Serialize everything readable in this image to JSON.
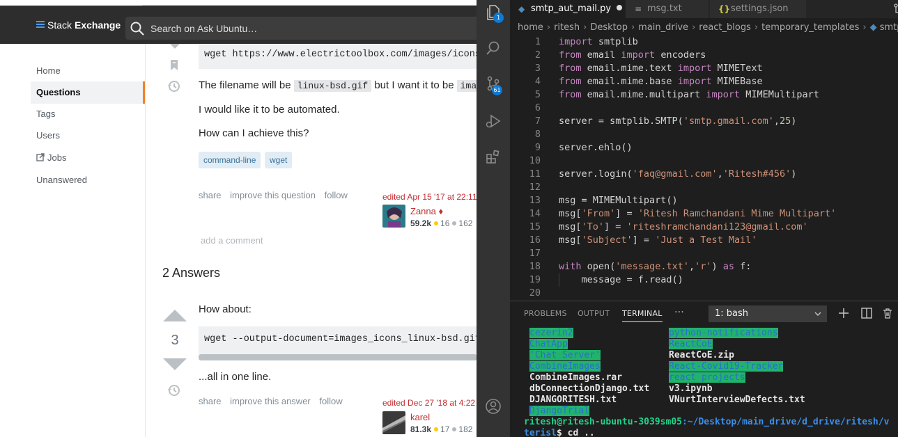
{
  "stack": {
    "brand_light": "Stack",
    "brand_bold": "Exchange",
    "search_placeholder": "Search on Ask Ubuntu…",
    "nav": {
      "home": "Home",
      "questions": "Questions",
      "tags": "Tags",
      "users": "Users",
      "jobs": "Jobs",
      "unanswered": "Unanswered"
    },
    "question": {
      "code_url": "wget https://www.electrictoolbox.com/images/icons/",
      "text1_a": "The filename will be",
      "text1_code1": "linux-bsd.gif",
      "text1_b": "but I want it to be",
      "text1_code2": "ima",
      "text2": "I would like it to be automated.",
      "text3": "How can I achieve this?",
      "tags": [
        "command-line",
        "wget"
      ],
      "share": "share",
      "improve": "improve this question",
      "follow": "follow",
      "edited": "edited Apr 15 '17 at 22:11",
      "user": "Zanna",
      "mod_mark": "♦",
      "rep": "59.2k",
      "gold": "16",
      "silver": "162",
      "add_comment": "add a comment"
    },
    "answers_header": "2 Answers",
    "answer": {
      "score": "3",
      "intro": "How about:",
      "code": "wget --output-document=images_icons_linux-bsd.gif",
      "outro": "...all in one line.",
      "share": "share",
      "improve": "improve this answer",
      "follow": "follow",
      "edited": "edited Dec 27 '18 at 4:22",
      "user": "karel",
      "rep": "81.3k",
      "gold": "17",
      "silver": "182"
    }
  },
  "vscode": {
    "tabs": [
      {
        "label": "smtp_aut_mail.py",
        "icon": "python-icon",
        "modified": true
      },
      {
        "label": "msg.txt",
        "icon": "text-lines-icon"
      },
      {
        "label": "settings.json",
        "icon": "json-braces-icon"
      }
    ],
    "badges": {
      "explorer": "1",
      "scm": "61"
    },
    "breadcrumb": [
      "home",
      "ritesh",
      "Desktop",
      "main_drive",
      "react_blogs",
      "temporary_templates",
      "smtp_a"
    ],
    "code_lines": [
      {
        "n": "1",
        "html": "<span class=\"kw\">import</span> smtplib"
      },
      {
        "n": "2",
        "html": "<span class=\"kw\">from</span> email <span class=\"kw\">import</span> encoders"
      },
      {
        "n": "3",
        "html": "<span class=\"kw\">from</span> email.mime.text <span class=\"kw\">import</span> MIMEText"
      },
      {
        "n": "4",
        "html": "<span class=\"kw\">from</span> email.mime.base <span class=\"kw\">import</span> MIMEBase"
      },
      {
        "n": "5",
        "html": "<span class=\"kw\">from</span> email.mime.multipart <span class=\"kw\">import</span> MIMEMultipart"
      },
      {
        "n": "6",
        "html": ""
      },
      {
        "n": "7",
        "html": "server = smtplib.SMTP(<span class=\"str\">'smtp.gmail.com'</span>,<span class=\"num\">25</span>)"
      },
      {
        "n": "8",
        "html": ""
      },
      {
        "n": "9",
        "html": "server.ehlo()"
      },
      {
        "n": "10",
        "html": ""
      },
      {
        "n": "11",
        "html": "server.login(<span class=\"str\">'faq@gmail.com'</span>,<span class=\"str\">'Ritesh#456'</span>)"
      },
      {
        "n": "12",
        "html": ""
      },
      {
        "n": "13",
        "html": "msg = MIMEMultipart()"
      },
      {
        "n": "14",
        "html": "msg[<span class=\"str\">'From'</span>] = <span class=\"str\">'Ritesh Ramchandani Mime Multipart'</span>"
      },
      {
        "n": "15",
        "html": "msg[<span class=\"str\">'To'</span>] = <span class=\"str\">'riteshramchandani123@gmail.com'</span>"
      },
      {
        "n": "16",
        "html": "msg[<span class=\"str\">'Subject'</span>] = <span class=\"str\">'Just a Test Mail'</span>"
      },
      {
        "n": "17",
        "html": ""
      },
      {
        "n": "18",
        "html": "<span class=\"kw\">with</span> open(<span class=\"str\">'message.txt'</span>,<span class=\"str\">'r'</span>) <span class=\"kw\">as</span> f:"
      },
      {
        "n": "19",
        "html": "    message = f.read()"
      },
      {
        "n": "20",
        "html": ""
      }
    ],
    "panel_tabs": [
      "PROBLEMS",
      "OUTPUT",
      "TERMINAL",
      "···"
    ],
    "terminal_select": "1: bash",
    "terminal_col1": [
      {
        "t": "cezerin2",
        "hl": true
      },
      {
        "t": "ChatApp",
        "hl": true
      },
      {
        "t": "'Chat Server'",
        "hl": true
      },
      {
        "t": "CombineImages",
        "hl": true
      },
      {
        "t": "CombineImages.rar",
        "hl": false
      },
      {
        "t": "dbConnectionDjango.txt",
        "hl": false
      },
      {
        "t": "DJANGORITESH.txt",
        "hl": false
      },
      {
        "t": "DjangoTrial",
        "hl": true
      }
    ],
    "terminal_col2": [
      {
        "t": "python-notifications",
        "hl": true
      },
      {
        "t": "ReactCoE",
        "hl": true
      },
      {
        "t": "ReactCoE.zip",
        "hl": false
      },
      {
        "t": "React-Covid19-Tracker",
        "hl": true
      },
      {
        "t": "react projects",
        "hl": true
      },
      {
        "t": "v3.ipynb",
        "hl": false
      },
      {
        "t": "VNurtInterviewDefects.txt",
        "hl": false
      }
    ],
    "prompt_user": "ritesh@ritesh-ubuntu-3039sm05",
    "prompt_path": ":~/Desktop/main_drive/d_drive/ritesh/v",
    "prompt2_user": "terisl",
    "prompt2_cmd": "$ cd .."
  },
  "colors": {
    "se_topbar": "#2d2d2d",
    "se_accent": "#f48024",
    "se_link": "#39739d",
    "vscode_bg": "#1e1e1e",
    "term_highlight": "#21b36d"
  }
}
